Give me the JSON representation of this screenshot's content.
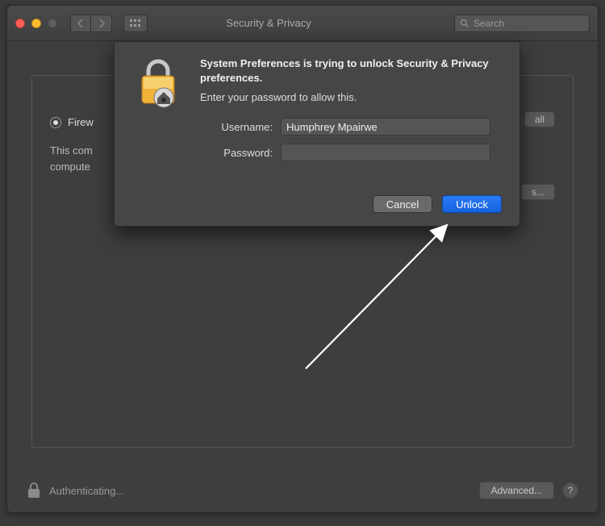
{
  "window": {
    "title": "Security & Privacy"
  },
  "toolbar": {
    "search_placeholder": "Search"
  },
  "tabs": {
    "firewall_label": "Firew"
  },
  "content": {
    "description": "This com\ncompute",
    "opt_right_1": "all",
    "opt_right_2": "s..."
  },
  "footer": {
    "status": "Authenticating...",
    "advanced_label": "Advanced...",
    "help_label": "?"
  },
  "dialog": {
    "heading": "System Preferences is trying to unlock Security & Privacy preferences.",
    "subheading": "Enter your password to allow this.",
    "username_label": "Username:",
    "password_label": "Password:",
    "username_value": "Humphrey Mpairwe",
    "password_value": "",
    "cancel_label": "Cancel",
    "submit_label": "Unlock"
  },
  "colors": {
    "primary": "#1f6fe5"
  }
}
